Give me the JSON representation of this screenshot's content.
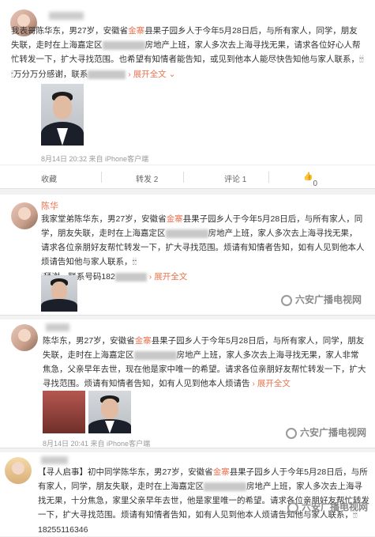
{
  "post1": {
    "avatar_name": "user-avatar",
    "username_suffix": "",
    "text": "我表哥陈华东，男27岁，安徽省金寨县果子园乡人于今年5月28日后，与所有家人，同学，朋友失联，走时在上海嘉定区",
    "text_mid": "房地产上班，家人多次去上海寻找无果，请求各位好心人帮忙转发一下，扩大寻找范围。也希望有知情者能告知，或见到他本人能尽快告知他与家人联系，",
    "text_end": "万分万分感谢，联系",
    "expand": "展开全文",
    "timestamp": "8月14日 20:32 来自 iPhone客户端",
    "actions": [
      "收藏",
      "转发 2",
      "评论 1",
      "0"
    ]
  },
  "post2": {
    "username": "陈华",
    "text": "我家堂弟陈华东，男27岁，安徽省金寨县果子园乡人于今年5月28日后，与所有家人，同学，朋友失联，走时在上海嘉定区",
    "text_mid": "房地产上班，家人多次去上海寻找无果，请求各位亲朋好友帮忙转发一下，扩大寻找范围。烦请有知情者告知，如有人见到他本人烦请告知他与家人联系，",
    "text_end": "拜谢，联系号码182",
    "expand": "展开全文",
    "watermark": "六安广播电视网"
  },
  "post3": {
    "text": "陈华东，男27岁，安徽省金寨县果子园乡人于今年5月28日后，与所有家人，同学，朋友失联，走时在上海嘉定区",
    "text_mid": "房地产上班，家人多次去上海寻找无果，家人非常焦急，父亲早年去世，现在他是家中唯一的希望。请求各位亲朋好友帮忙转发一下，扩大寻找范围。烦请有知情者告知，如有人见到他本人烦请告",
    "expand": "展开全文",
    "timestamp": "8月14日 20:41 来自 iPhone客户端",
    "watermark": "六安广播电视网"
  },
  "post4": {
    "text": "【寻人启事】初中同学陈华东，男27岁，安徽省金寨县果子园乡人于今年5月28日后，与所有家人，同学，朋友失联，走时在上海嘉定区",
    "text_mid": "房地产上班，家人多次去上海寻找无果，十分焦急，家里父亲早年去世，他是家里唯一的希望。请求各位亲朋好友帮忙转发一下，扩大寻找范围。烦请有知情者告知，如有人见到他本人烦请告知他与家人联系，",
    "phone": "18255116346",
    "watermark": "六安广播电视网"
  }
}
